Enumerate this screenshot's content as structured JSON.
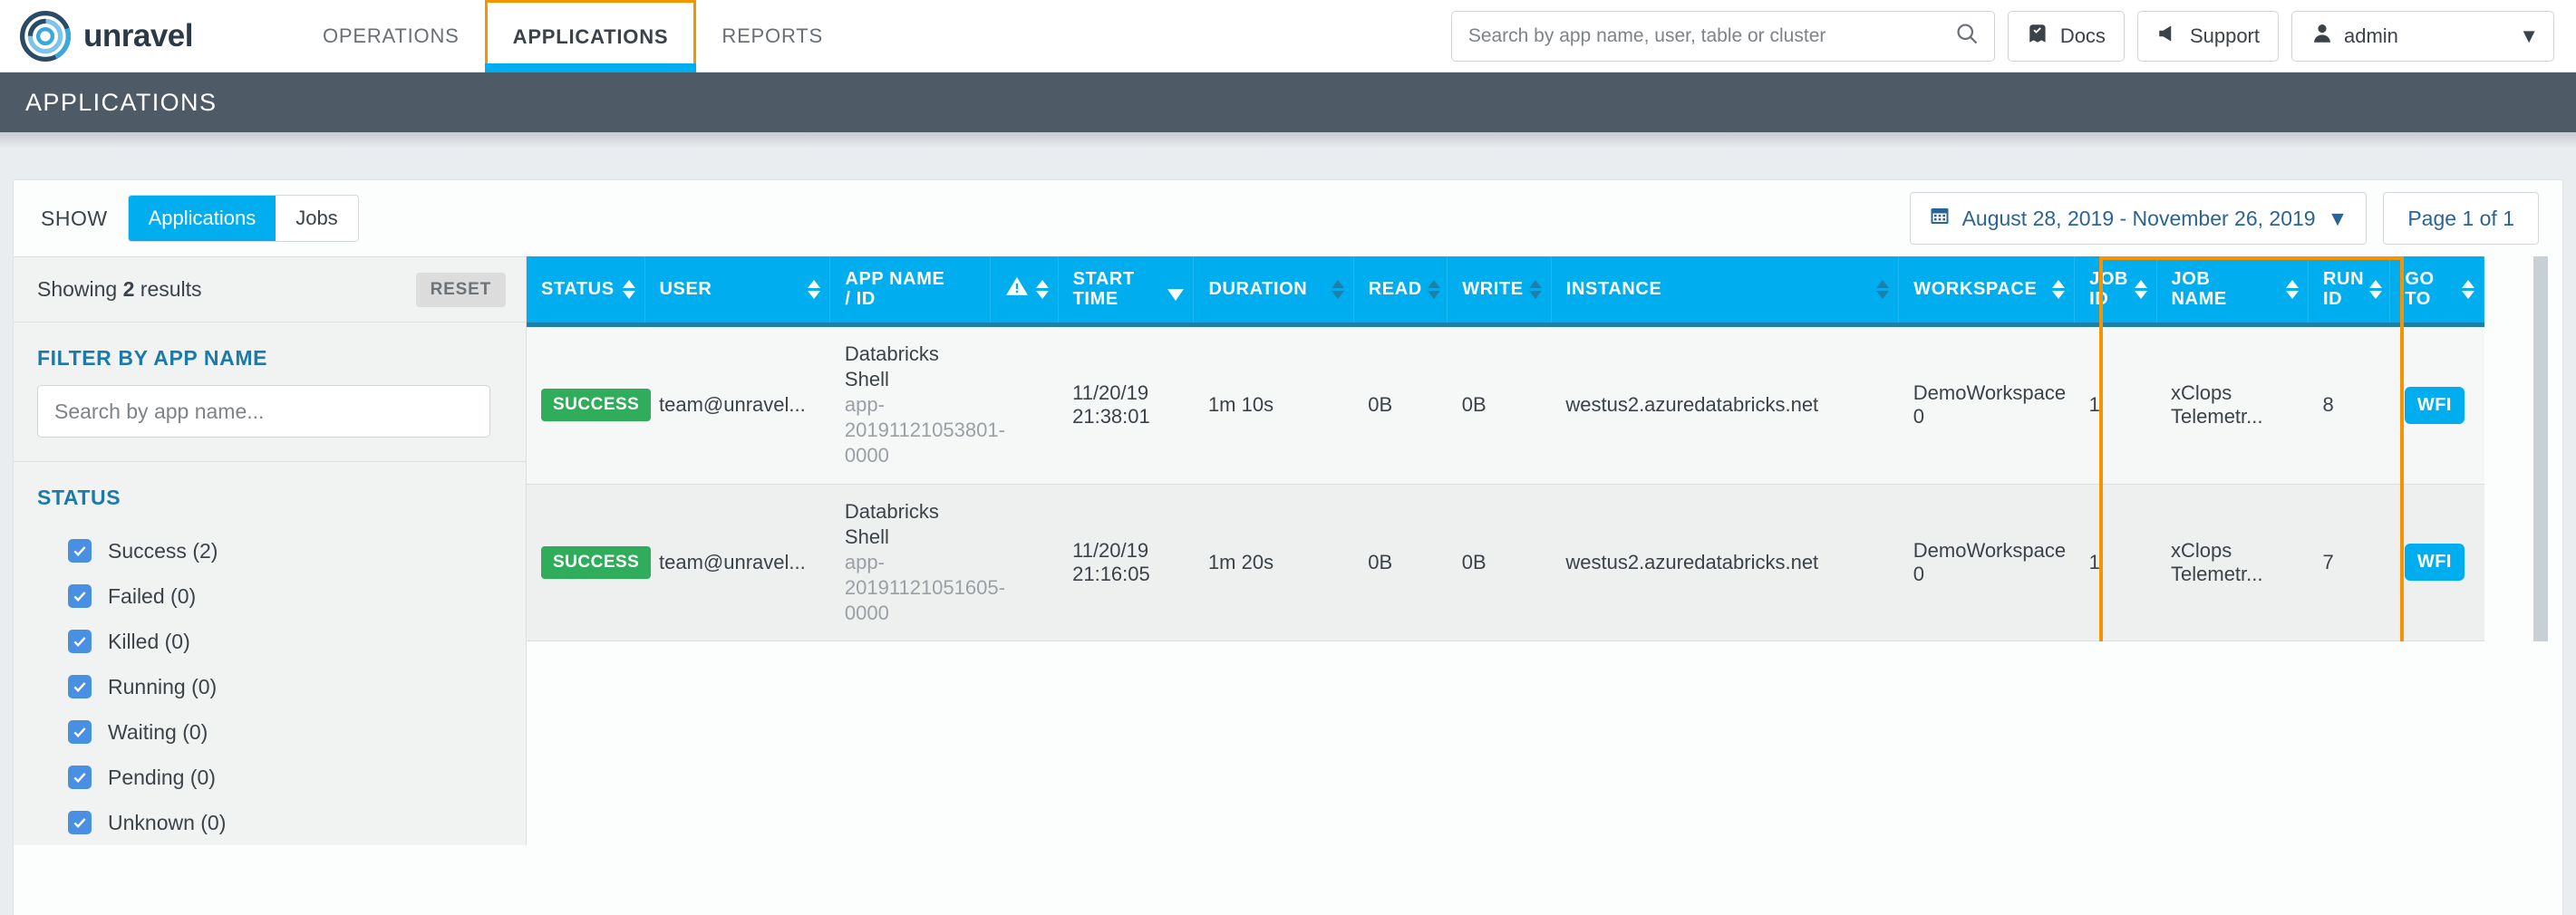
{
  "brand": {
    "name": "unravel",
    "logo_icon": "unravel-knot-logo"
  },
  "topnav": {
    "items": [
      {
        "label": "OPERATIONS",
        "active": false
      },
      {
        "label": "APPLICATIONS",
        "active": true
      },
      {
        "label": "REPORTS",
        "active": false
      }
    ],
    "search": {
      "value": "",
      "placeholder": "Search by app name, user, table or cluster",
      "icon": "search-icon"
    },
    "docs": {
      "label": "Docs",
      "icon": "book-icon"
    },
    "support": {
      "label": "Support",
      "icon": "megaphone-icon"
    },
    "user": {
      "label": "admin",
      "icon": "user-icon",
      "caret": "▼"
    }
  },
  "page": {
    "title": "APPLICATIONS"
  },
  "toolbar": {
    "show_label": "SHOW",
    "segments": [
      {
        "label": "Applications",
        "active": true
      },
      {
        "label": "Jobs",
        "active": false
      }
    ],
    "date_range": {
      "label": "August 28, 2019 - November 26, 2019",
      "icon": "calendar-icon",
      "caret": "▼"
    },
    "page_indicator": "Page 1 of 1"
  },
  "sidebar": {
    "showing_prefix": "Showing ",
    "showing_count": "2",
    "showing_suffix": " results",
    "reset_label": "RESET",
    "filter_app_name": {
      "title": "FILTER BY APP NAME",
      "input_value": "",
      "input_placeholder": "Search by app name..."
    },
    "status": {
      "title": "STATUS",
      "items": [
        {
          "label": "Success (2)",
          "checked": true
        },
        {
          "label": "Failed (0)",
          "checked": true
        },
        {
          "label": "Killed (0)",
          "checked": true
        },
        {
          "label": "Running (0)",
          "checked": true
        },
        {
          "label": "Waiting (0)",
          "checked": true
        },
        {
          "label": "Pending (0)",
          "checked": true
        },
        {
          "label": "Unknown (0)",
          "checked": true
        }
      ]
    }
  },
  "table": {
    "columns": [
      {
        "label": "STATUS",
        "sort": "both"
      },
      {
        "label": "USER",
        "sort": "both"
      },
      {
        "label": "APP NAME\n/ ID",
        "sort": "none"
      },
      {
        "label": "",
        "icon": "warning-triangle-icon",
        "sort": "both"
      },
      {
        "label": "START\nTIME",
        "sort": "desc-active"
      },
      {
        "label": "DURATION",
        "sort": "both"
      },
      {
        "label": "READ",
        "sort": "both"
      },
      {
        "label": "WRITE",
        "sort": "both"
      },
      {
        "label": "INSTANCE",
        "sort": "both"
      },
      {
        "label": "WORKSPACE",
        "sort": "both"
      },
      {
        "label": "JOB\nID",
        "sort": "both"
      },
      {
        "label": "JOB\nNAME",
        "sort": "both"
      },
      {
        "label": "RUN\nID",
        "sort": "both"
      },
      {
        "label": "GO\nTO",
        "sort": "both"
      }
    ],
    "rows": [
      {
        "status": "SUCCESS",
        "user": "team@unravel...",
        "app_name": "Databricks Shell",
        "app_id": "app-20191121053801-0000",
        "alert": "",
        "start_time_date": "11/20/19",
        "start_time_clock": "21:38:01",
        "duration": "1m 10s",
        "read": "0B",
        "write": "0B",
        "instance": "westus2.azuredatabricks.net",
        "workspace": "DemoWorkspace 0",
        "job_id": "1",
        "job_name": "xClops Telemetr...",
        "run_id": "8",
        "goto": "WFI"
      },
      {
        "status": "SUCCESS",
        "user": "team@unravel...",
        "app_name": "Databricks Shell",
        "app_id": "app-20191121051605-0000",
        "alert": "",
        "start_time_date": "11/20/19",
        "start_time_clock": "21:16:05",
        "duration": "1m 20s",
        "read": "0B",
        "write": "0B",
        "instance": "westus2.azuredatabricks.net",
        "workspace": "DemoWorkspace 0",
        "job_id": "1",
        "job_name": "xClops Telemetr...",
        "run_id": "7",
        "goto": "WFI"
      }
    ]
  },
  "colors": {
    "accent_cyan": "#00aeef",
    "highlight_orange": "#f59300",
    "success_green": "#2fad5a",
    "titlebar_slate": "#4e5b66",
    "link_blue": "#2a6496",
    "checkbox_blue": "#4a90e2"
  }
}
